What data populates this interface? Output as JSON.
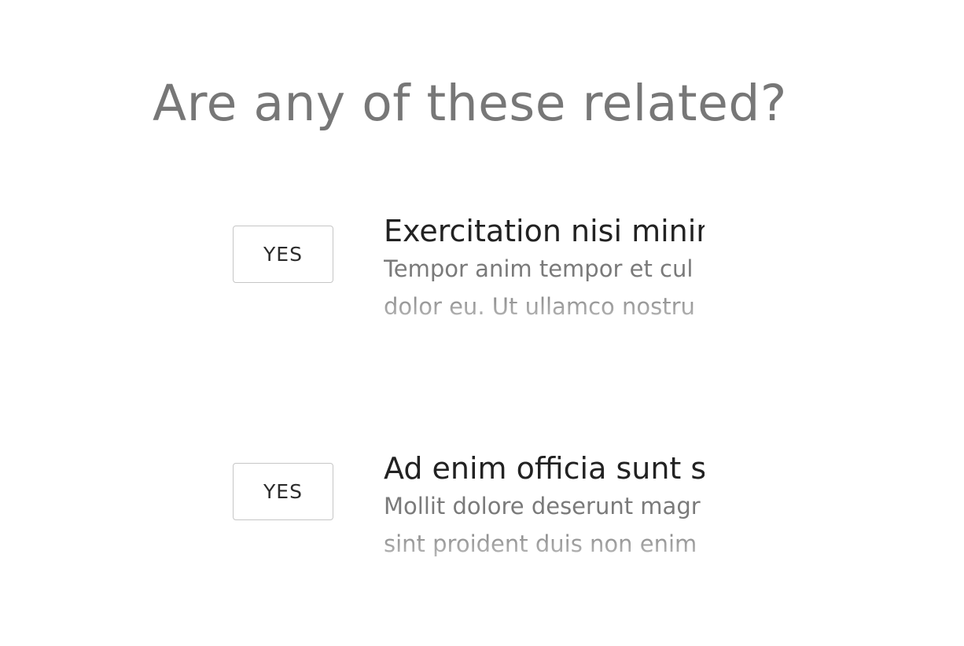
{
  "page": {
    "title": "Are any of these related?"
  },
  "suggestions": [
    {
      "button_label": "YES",
      "title": "Exercitation nisi minim",
      "body_line1": "Tempor anim tempor et cul",
      "body_line2": "dolor eu. Ut ullamco nostru"
    },
    {
      "button_label": "YES",
      "title": "Ad enim officia sunt s",
      "body_line1": "Mollit dolore deserunt magr",
      "body_line2": "sint proident duis non enim"
    }
  ],
  "colors": {
    "title": "#777777",
    "heading_text": "#222222",
    "body_text": "#7a7a7a",
    "button_border": "#c6c6c6"
  }
}
